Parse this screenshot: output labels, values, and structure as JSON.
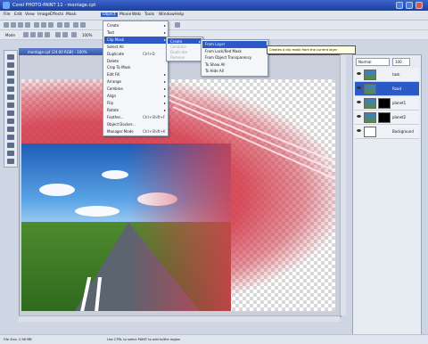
{
  "window": {
    "title": "Corel PHOTO-PAINT 11 - montage.cpt"
  },
  "menubar": {
    "items": [
      "File",
      "Edit",
      "View",
      "Image",
      "Effects",
      "Mask",
      "Object",
      "Movie",
      "Web",
      "Tools",
      "Window",
      "Help"
    ],
    "active": "Object"
  },
  "toolbar": {
    "mode_label": "Mode",
    "zoom_label": "100%"
  },
  "document": {
    "title": "montage.cpt (24.00 RGB) - 100%"
  },
  "object_menu": [
    {
      "label": "Create",
      "has_submenu": true
    },
    {
      "label": "Text",
      "has_submenu": true
    },
    {
      "label": "Clip Mask",
      "has_submenu": true,
      "highlighted": true
    },
    {
      "label": "Select All",
      "shortcut": ""
    },
    {
      "label": "Duplicate",
      "shortcut": "Ctrl+D"
    },
    {
      "label": "Delete",
      "shortcut": ""
    },
    {
      "label": "Crop To Mask",
      "shortcut": ""
    },
    {
      "label": "Edit Fill",
      "has_submenu": true
    },
    {
      "label": "Arrange",
      "has_submenu": true
    },
    {
      "label": "Combine",
      "has_submenu": true
    },
    {
      "label": "Align",
      "has_submenu": true
    },
    {
      "label": "Flip",
      "has_submenu": true
    },
    {
      "label": "Rotate",
      "has_submenu": true
    },
    {
      "label": "Feather...",
      "shortcut": "Ctrl+Shift+F"
    },
    {
      "label": "Object Docker...",
      "shortcut": ""
    },
    {
      "label": "Manager Mode",
      "shortcut": "Ctrl+Shift+K"
    }
  ],
  "clipmask_submenu": [
    {
      "label": "Create",
      "has_submenu": true,
      "highlighted": true
    },
    {
      "label": "Combine",
      "disabled": true
    },
    {
      "label": "Duplicate",
      "disabled": true
    },
    {
      "label": "Remove",
      "disabled": true
    }
  ],
  "create_submenu": [
    {
      "label": "From Layer",
      "highlighted": true
    },
    {
      "label": "From Lock/Red Mask"
    },
    {
      "label": "From Object Transparency"
    },
    {
      "label": "To Show All"
    },
    {
      "label": "To Hide All"
    }
  ],
  "tooltip": "Creates a clip mask from the current layer",
  "layers_panel": {
    "blend_mode": "Normal",
    "opacity": "100",
    "layers": [
      {
        "name": "task",
        "active": false
      },
      {
        "name": "Road",
        "active": true
      },
      {
        "name": "planet1",
        "active": false
      },
      {
        "name": "planet2",
        "active": false
      },
      {
        "name": "Background",
        "active": false
      }
    ]
  },
  "status": {
    "left": "File Size: 2.98 MB",
    "center": "Use CTRL to select PAINT to add to/the region"
  },
  "colors": {
    "accent": "#2b59c8",
    "red_layer": "#d43e4e"
  }
}
